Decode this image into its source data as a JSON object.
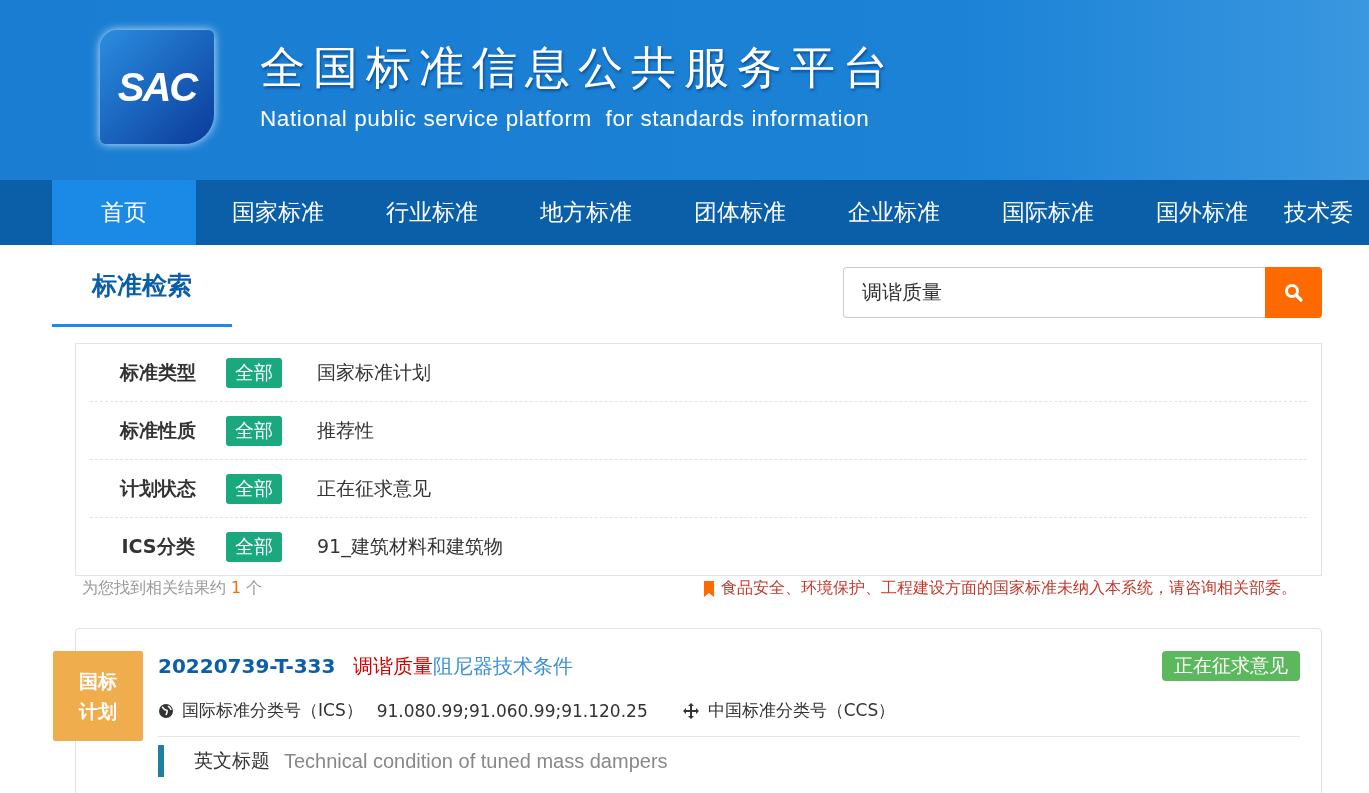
{
  "header": {
    "logo_text": "SAC",
    "title": "全国标准信息公共服务平台",
    "subtitle": "National public service platform  for standards information"
  },
  "nav": [
    {
      "label": "首页",
      "selected": true
    },
    {
      "label": "国家标准",
      "selected": false
    },
    {
      "label": "行业标准",
      "selected": false
    },
    {
      "label": "地方标准",
      "selected": false
    },
    {
      "label": "团体标准",
      "selected": false
    },
    {
      "label": "企业标准",
      "selected": false
    },
    {
      "label": "国际标准",
      "selected": false
    },
    {
      "label": "国外标准",
      "selected": false
    },
    {
      "label": "技术委",
      "selected": false
    }
  ],
  "search_tab": "标准检索",
  "search": {
    "value": "调谐质量"
  },
  "filters": [
    {
      "label": "标准类型",
      "tag": "全部",
      "value": "国家标准计划"
    },
    {
      "label": "标准性质",
      "tag": "全部",
      "value": "推荐性"
    },
    {
      "label": "计划状态",
      "tag": "全部",
      "value": "正在征求意见"
    },
    {
      "label": "ICS分类",
      "tag": "全部",
      "value": "91_建筑材料和建筑物"
    }
  ],
  "result_summary": {
    "prefix": "为您找到相关结果约",
    "count": "1",
    "suffix": "个"
  },
  "notice": "食品安全、环境保护、工程建设方面的国家标准未纳入本系统，请咨询相关部委。",
  "results": [
    {
      "badge_lines": [
        "国标",
        "计划"
      ],
      "code": "20220739-T-333",
      "title_highlight": "调谐质量",
      "title_rest": "阻尼器技术条件",
      "status": "正在征求意见",
      "ics_label": "国际标准分类号（ICS）",
      "ics_value": "91.080.99;91.060.99;91.120.25",
      "ccs_label": "中国标准分类号（CCS）",
      "en_label": "英文标题",
      "en_title": "Technical condition of tuned mass dampers"
    }
  ]
}
